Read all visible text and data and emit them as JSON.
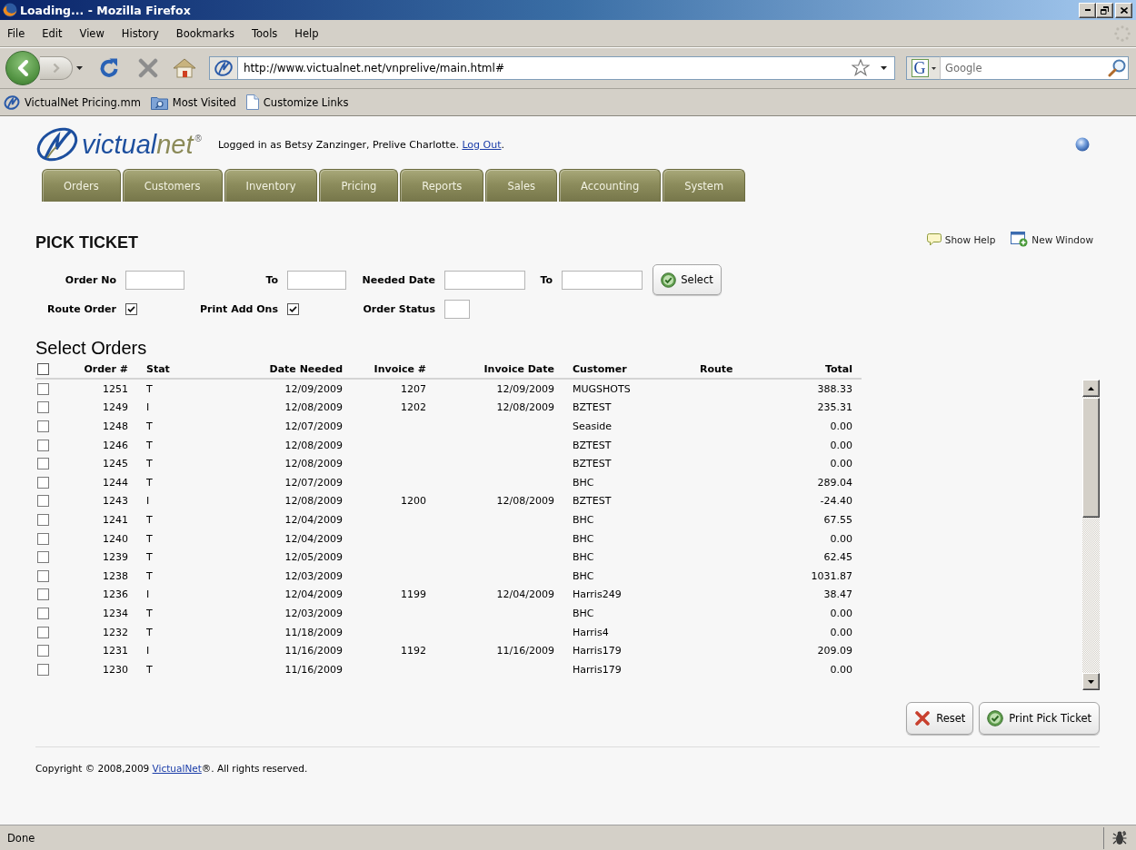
{
  "window": {
    "title": "Loading... - Mozilla Firefox"
  },
  "menu": [
    "File",
    "Edit",
    "View",
    "History",
    "Bookmarks",
    "Tools",
    "Help"
  ],
  "address_bar": {
    "url": "http://www.victualnet.net/vnprelive/main.html#"
  },
  "search": {
    "engine_glyph": "G",
    "placeholder": "Google"
  },
  "bookmarks": [
    {
      "label": "VictualNet Pricing.mm",
      "kind": "site"
    },
    {
      "label": "Most Visited",
      "kind": "folder"
    },
    {
      "label": "Customize Links",
      "kind": "page"
    }
  ],
  "header": {
    "brand": {
      "name": "victual",
      "name_accent": "net",
      "mark": "®"
    },
    "login_text": "Logged in as Betsy Zanzinger, Prelive Charlotte.",
    "logout_link": "Log Out",
    "login_end": "."
  },
  "tabs": [
    {
      "label": "Orders",
      "selected": false
    },
    {
      "label": "Customers",
      "selected": false
    },
    {
      "label": "Inventory",
      "selected": false
    },
    {
      "label": "Pricing",
      "selected": false
    },
    {
      "label": "Reports",
      "selected": false
    },
    {
      "label": "Sales",
      "selected": false
    },
    {
      "label": "Accounting",
      "selected": false
    },
    {
      "label": "System",
      "selected": false
    }
  ],
  "page": {
    "title": "PICK TICKET",
    "links": [
      {
        "label": "Show Help",
        "kind": "help"
      },
      {
        "label": "New Window",
        "kind": "window"
      }
    ]
  },
  "filters": {
    "rows": [
      {
        "items": [
          {
            "kind": "number",
            "label": "Order No"
          },
          {
            "kind": "number",
            "label": "To"
          },
          {
            "kind": "date",
            "label": "Needed Date"
          },
          {
            "kind": "date",
            "label": "To"
          },
          {
            "kind": "button",
            "label": "Select"
          }
        ]
      },
      {
        "items": [
          {
            "kind": "check",
            "label": "Route Order",
            "checked": true
          },
          {
            "kind": "check",
            "label": "Print Add Ons",
            "checked": true
          },
          {
            "kind": "code",
            "label": "Order Status"
          }
        ]
      }
    ]
  },
  "orders": {
    "title": "Select Orders",
    "select_all": {
      "checked": false
    },
    "columns": [
      "Order #",
      "Stat",
      "Date Needed",
      "Invoice #",
      "Invoice Date",
      "Customer",
      "Route",
      "Total"
    ],
    "rows": [
      {
        "checked": false,
        "order": "1251",
        "stat": "T",
        "date_needed": "12/09/2009",
        "invoice": "1207",
        "invoice_date": "12/09/2009",
        "customer": "MUGSHOTS",
        "total": "388.33"
      },
      {
        "checked": false,
        "order": "1249",
        "stat": "I",
        "date_needed": "12/08/2009",
        "invoice": "1202",
        "invoice_date": "12/08/2009",
        "customer": "BZTEST",
        "total": "235.31"
      },
      {
        "checked": false,
        "order": "1248",
        "stat": "T",
        "date_needed": "12/07/2009",
        "customer": "Seaside",
        "total": "0.00"
      },
      {
        "checked": false,
        "order": "1246",
        "stat": "T",
        "date_needed": "12/08/2009",
        "customer": "BZTEST",
        "total": "0.00"
      },
      {
        "checked": false,
        "order": "1245",
        "stat": "T",
        "date_needed": "12/08/2009",
        "customer": "BZTEST",
        "total": "0.00"
      },
      {
        "checked": false,
        "order": "1244",
        "stat": "T",
        "date_needed": "12/07/2009",
        "customer": "BHC",
        "total": "289.04"
      },
      {
        "checked": false,
        "order": "1243",
        "stat": "I",
        "date_needed": "12/08/2009",
        "invoice": "1200",
        "invoice_date": "12/08/2009",
        "customer": "BZTEST",
        "total": "-24.40"
      },
      {
        "checked": false,
        "order": "1241",
        "stat": "T",
        "date_needed": "12/04/2009",
        "customer": "BHC",
        "total": "67.55"
      },
      {
        "checked": false,
        "order": "1240",
        "stat": "T",
        "date_needed": "12/04/2009",
        "customer": "BHC",
        "total": "0.00"
      },
      {
        "checked": false,
        "order": "1239",
        "stat": "T",
        "date_needed": "12/05/2009",
        "customer": "BHC",
        "total": "62.45"
      },
      {
        "checked": false,
        "order": "1238",
        "stat": "T",
        "date_needed": "12/03/2009",
        "customer": "BHC",
        "total": "1031.87"
      },
      {
        "checked": false,
        "order": "1236",
        "stat": "I",
        "date_needed": "12/04/2009",
        "invoice": "1199",
        "invoice_date": "12/04/2009",
        "customer": "Harris249",
        "total": "38.47"
      },
      {
        "checked": false,
        "order": "1234",
        "stat": "T",
        "date_needed": "12/03/2009",
        "customer": "BHC",
        "total": "0.00"
      },
      {
        "checked": false,
        "order": "1232",
        "stat": "T",
        "date_needed": "11/18/2009",
        "customer": "Harris4",
        "total": "0.00"
      },
      {
        "checked": false,
        "order": "1231",
        "stat": "I",
        "date_needed": "11/16/2009",
        "invoice": "1192",
        "invoice_date": "11/16/2009",
        "customer": "Harris179",
        "total": "209.09"
      },
      {
        "checked": false,
        "order": "1230",
        "stat": "T",
        "date_needed": "11/16/2009",
        "customer": "Harris179",
        "total": "0.00"
      }
    ]
  },
  "actions": [
    {
      "label": "Reset",
      "kind": "reset"
    },
    {
      "label": "Print Pick Ticket",
      "kind": "confirm"
    }
  ],
  "footer": {
    "text": "Copyright © 2008,2009",
    "link": "VictualNet",
    "text_end": "®. All rights reserved."
  },
  "status_bar": {
    "text": "Done"
  }
}
